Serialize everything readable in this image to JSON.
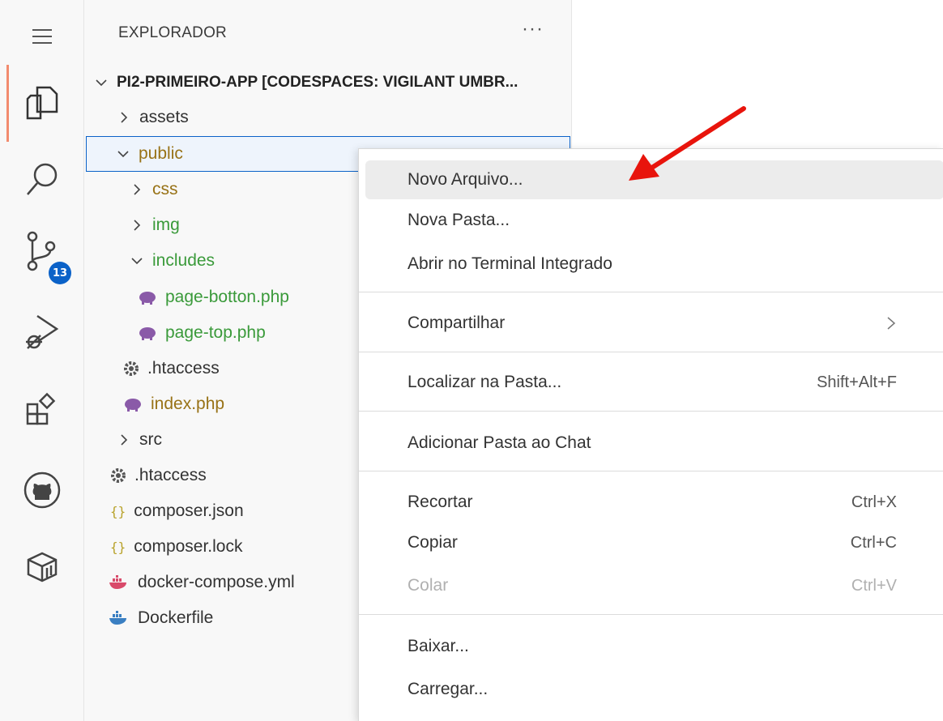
{
  "activity_bar": {
    "items": [
      {
        "icon": "menu-icon"
      },
      {
        "icon": "explorer-icon"
      },
      {
        "icon": "search-icon"
      },
      {
        "icon": "source-control-icon",
        "badge": "13"
      },
      {
        "icon": "run-debug-icon"
      },
      {
        "icon": "extensions-icon"
      },
      {
        "icon": "github-icon"
      },
      {
        "icon": "remote-explorer-icon"
      }
    ],
    "active_color": "#f28b6e",
    "badge_color": "#0b62c8"
  },
  "explorer": {
    "title": "EXPLORADOR",
    "more": "···",
    "root_label": "PI2-PRIMEIRO-APP [CODESPACES: VIGILANT UMBR...",
    "tree": [
      {
        "label": "assets",
        "type": "folder-collapsed"
      },
      {
        "label": "public",
        "type": "folder-expanded",
        "selected": true
      },
      {
        "label": "css",
        "type": "folder-collapsed"
      },
      {
        "label": "img",
        "type": "folder-collapsed"
      },
      {
        "label": "includes",
        "type": "folder-expanded"
      },
      {
        "label": "page-botton.php",
        "type": "php-file"
      },
      {
        "label": "page-top.php",
        "type": "php-file"
      },
      {
        "label": ".htaccess",
        "type": "config-file"
      },
      {
        "label": "index.php",
        "type": "php-file"
      },
      {
        "label": "src",
        "type": "folder-collapsed"
      },
      {
        "label": ".htaccess",
        "type": "config-file"
      },
      {
        "label": "composer.json",
        "type": "json-file"
      },
      {
        "label": "composer.lock",
        "type": "json-file"
      },
      {
        "label": "docker-compose.yml",
        "type": "docker-file"
      },
      {
        "label": "Dockerfile",
        "type": "docker-file"
      }
    ]
  },
  "context_menu": {
    "items": [
      {
        "label": "Novo Arquivo...",
        "shortcut": "",
        "hovered": true
      },
      {
        "label": "Nova Pasta...",
        "shortcut": ""
      },
      {
        "label": "Abrir no Terminal Integrado",
        "shortcut": ""
      },
      {
        "label": "Compartilhar",
        "shortcut": "",
        "submenu": true
      },
      {
        "label": "Localizar na Pasta...",
        "shortcut": "Shift+Alt+F"
      },
      {
        "label": "Adicionar Pasta ao Chat",
        "shortcut": ""
      },
      {
        "label": "Recortar",
        "shortcut": "Ctrl+X"
      },
      {
        "label": "Copiar",
        "shortcut": "Ctrl+C"
      },
      {
        "label": "Colar",
        "shortcut": "Ctrl+V",
        "disabled": true
      },
      {
        "label": "Baixar...",
        "shortcut": ""
      },
      {
        "label": "Carregar...",
        "shortcut": ""
      }
    ]
  },
  "annotation": {
    "arrow_color": "#e8140c"
  }
}
